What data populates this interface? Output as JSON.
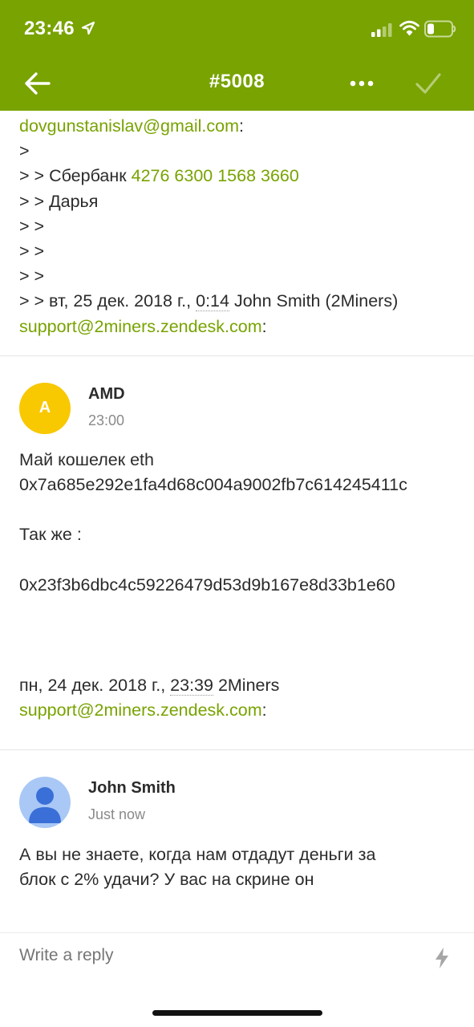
{
  "status_bar": {
    "time": "23:46"
  },
  "nav": {
    "title": "#5008"
  },
  "quoted_block": {
    "email_line": {
      "link": "dovgunstanislav@gmail.com",
      "suffix": ":"
    },
    "lines": [
      {
        "prefix": ">",
        "text": ""
      },
      {
        "prefix": "> > ",
        "text": "Сбербанк ",
        "link": "4276 6300 1568 3660"
      },
      {
        "prefix": "> > ",
        "text": "Дарья"
      },
      {
        "prefix": "> >",
        "text": ""
      },
      {
        "prefix": "> >",
        "text": ""
      },
      {
        "prefix": "> >",
        "text": ""
      }
    ],
    "date_line": {
      "prefix": "> > вт, 25 дек. 2018 г., ",
      "time": "0:14",
      "suffix": " John Smith (2Miners)"
    },
    "support_line": {
      "link": "support@2miners.zendesk.com",
      "suffix": ":"
    }
  },
  "comments": [
    {
      "avatar_letter": "A",
      "author": "AMD",
      "time": "23:00",
      "body": [
        "Май кошелек eth",
        "0x7a685e292e1fa4d68c004a9002fb7c614245411c",
        "",
        "Так же :",
        "",
        "0x23f3b6dbc4c59226479d53d9b167e8d33b1e60"
      ],
      "date_line": {
        "prefix": "пн, 24 дек. 2018 г., ",
        "time": "23:39",
        "suffix": " 2Miners"
      },
      "support_line": {
        "link": "support@2miners.zendesk.com",
        "suffix": ":"
      }
    },
    {
      "author": "John Smith",
      "time": "Just now",
      "body": [
        "А вы не знаете, когда нам отдадут деньги за",
        "блок с 2% удачи? У вас на скрине он"
      ]
    }
  ],
  "reply": {
    "placeholder": "Write a reply"
  },
  "colors": {
    "brand": "#78a300",
    "amd_avatar": "#f8c800",
    "user_avatar": "#a9c8f5"
  }
}
